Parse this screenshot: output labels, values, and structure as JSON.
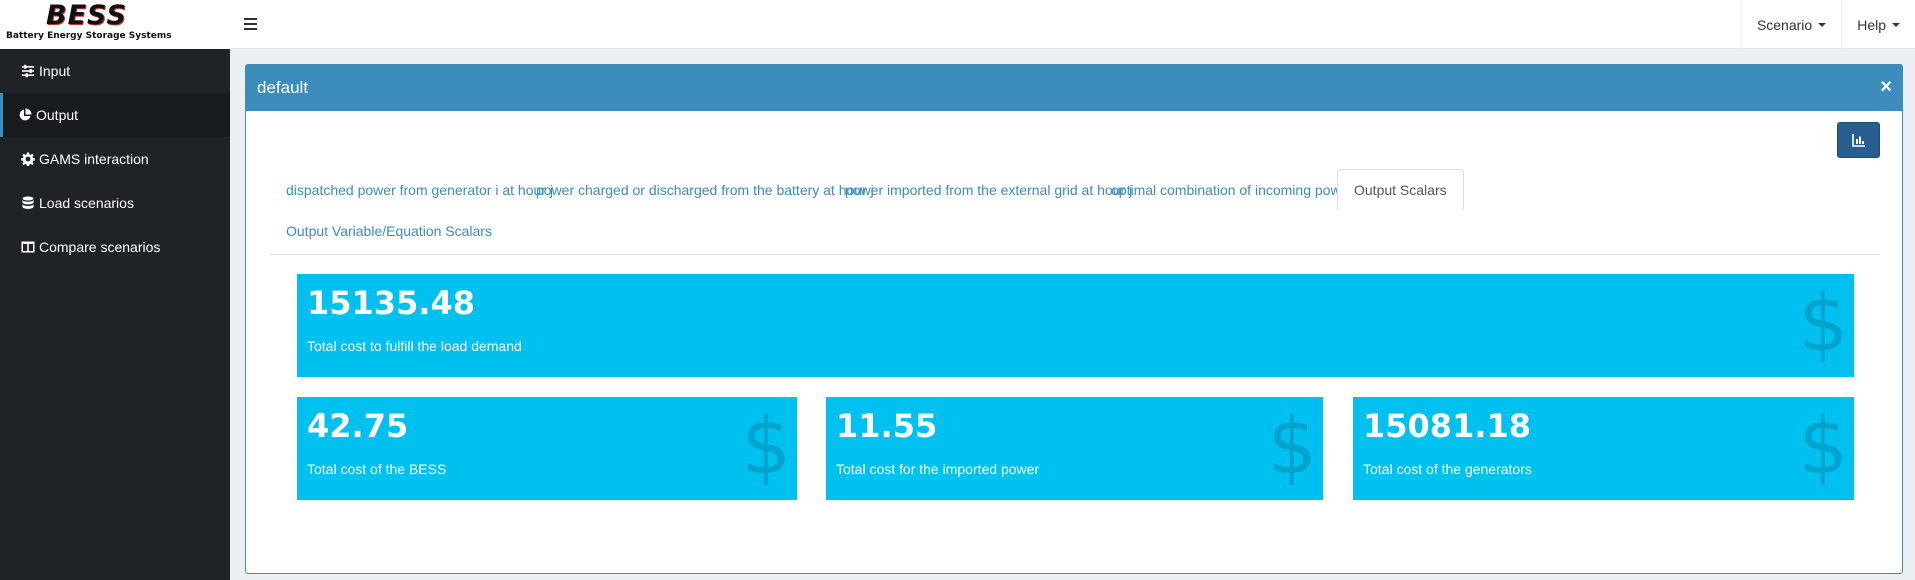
{
  "header": {
    "logo_title": "BESS",
    "logo_subtitle": "Battery Energy Storage Systems",
    "menu_toggle_icon": "hamburger-icon",
    "nav": [
      {
        "label": "Scenario"
      },
      {
        "label": "Help"
      }
    ]
  },
  "sidebar": {
    "items": [
      {
        "label": "Input",
        "icon": "sliders-icon",
        "active": false
      },
      {
        "label": "Output",
        "icon": "pie-chart-icon",
        "active": true
      },
      {
        "label": "GAMS interaction",
        "icon": "gear-icon",
        "active": false
      },
      {
        "label": "Load scenarios",
        "icon": "database-icon",
        "active": false
      },
      {
        "label": "Compare scenarios",
        "icon": "columns-icon",
        "active": false
      }
    ]
  },
  "box": {
    "title": "default",
    "close_label": "×",
    "tabs": [
      {
        "label": "dispatched power from generator i at hour j"
      },
      {
        "label": "power charged or discharged from the battery at hour j"
      },
      {
        "label": "power imported from the external grid at hour j"
      },
      {
        "label": "optimal combination of incoming power flows"
      },
      {
        "label": "Output Scalars"
      },
      {
        "label": "Output Variable/Equation Scalars"
      }
    ],
    "active_tab": "Output Scalars",
    "value_boxes": [
      {
        "value": "15135.48",
        "label": "Total cost to fulfill the load demand",
        "icon": "dollar-icon"
      },
      {
        "value": "42.75",
        "label": "Total cost of the BESS",
        "icon": "dollar-icon"
      },
      {
        "value": "11.55",
        "label": "Total cost for the imported power",
        "icon": "dollar-icon"
      },
      {
        "value": "15081.18",
        "label": "Total cost of the generators",
        "icon": "dollar-icon"
      }
    ],
    "dollar_glyph": "$"
  },
  "colors": {
    "primary": "#3c8dbc",
    "value_box": "#00c0ef",
    "sidebar_bg": "#1f2326",
    "chart_button": "#285e8e"
  }
}
